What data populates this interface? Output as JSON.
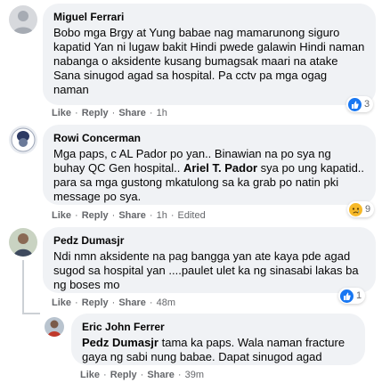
{
  "comments": [
    {
      "author": "Miguel Ferrari",
      "text": "Bobo mga Brgy at Yung babae nag mamarunong siguro kapatid Yan ni lugaw bakit Hindi pwede galawin Hindi naman nabanga o aksidente kusang bumagsak maari na atake Sana sinugod agad sa hospital. Pa cctv pa mga ogag naman",
      "like": "Like",
      "reply": "Reply",
      "share": "Share",
      "time": "1h",
      "reaction_count": "3",
      "reaction_icon": "like-icon"
    },
    {
      "author": "Rowi Concerman",
      "text_before": "Mga paps, c AL Pador po yan.. Binawian na po sya ng buhay QC Gen hospital.. ",
      "mention": "Ariel T. Pador",
      "text_after": " sya po ung kapatid.. para sa mga gustong mkatulong sa ka grab po natin pki message po sya.",
      "like": "Like",
      "reply": "Reply",
      "share": "Share",
      "time": "1h",
      "edited": "Edited",
      "reaction_count": "9",
      "reaction_icon": "sad-icon"
    },
    {
      "author": "Pedz Dumasjr",
      "text": "Ndi nmn aksidente na pag bangga yan ate kaya pde agad sugod sa hospital yan ....paulet ulet ka ng sinasabi lakas ba ng boses mo",
      "like": "Like",
      "reply": "Reply",
      "share": "Share",
      "time": "48m",
      "reaction_count": "1",
      "reaction_icon": "like-icon"
    },
    {
      "author": "Eric John Ferrer",
      "mention": "Pedz Dumasjr",
      "text_after": " tama ka paps. Wala naman fracture gaya ng sabi nung babae. Dapat sinugod agad",
      "like": "Like",
      "reply": "Reply",
      "share": "Share",
      "time": "39m"
    }
  ],
  "colors": {
    "bubble": "#f0f2f5",
    "meta_text": "#65676b",
    "like_blue": "#1877f2",
    "sad_yellow": "#f7b928"
  }
}
